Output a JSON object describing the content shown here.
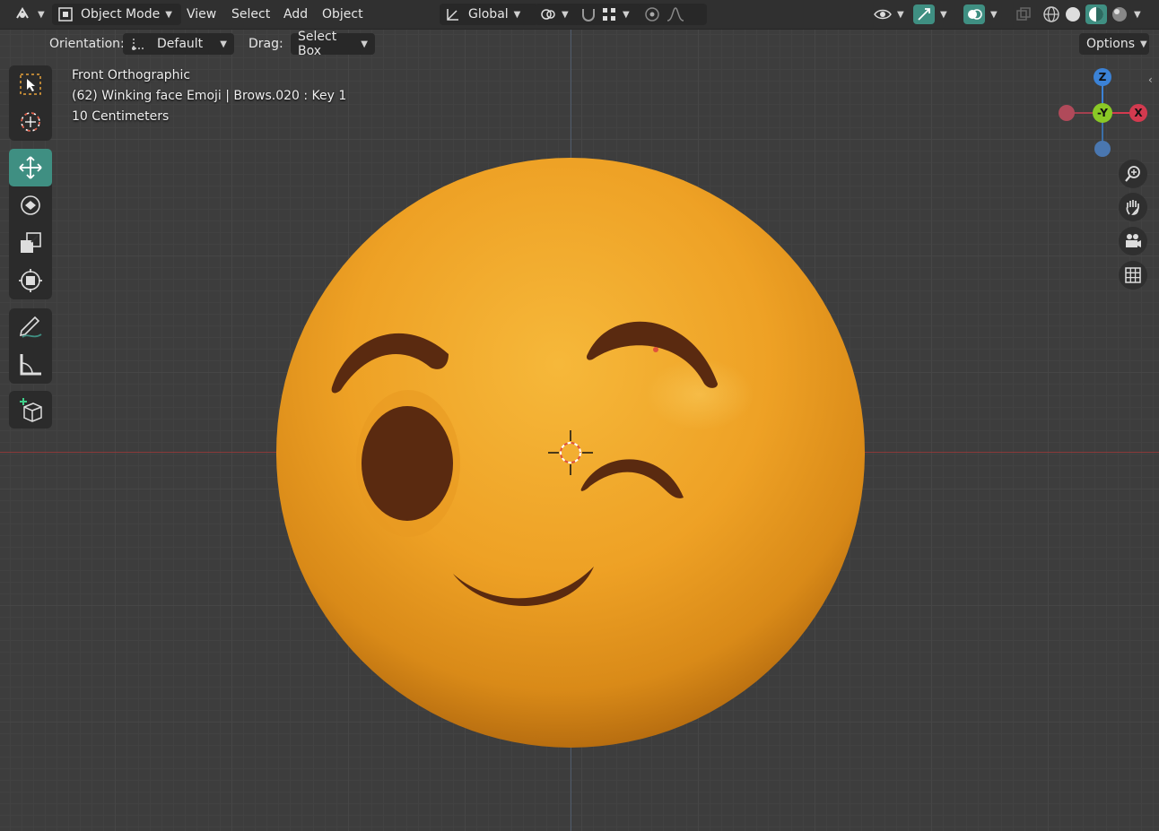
{
  "header": {
    "editor_type_icon": "editor-type-icon",
    "mode": "Object Mode",
    "menus": [
      "View",
      "Select",
      "Add",
      "Object"
    ],
    "transform_orientation": "Global",
    "options_label": "Options"
  },
  "tool_settings": {
    "orientation_label": "Orientation:",
    "orientation_value": "Default",
    "drag_label": "Drag:",
    "drag_value": "Select Box"
  },
  "overlay": {
    "view_name": "Front Orthographic",
    "object_info": "(62) Winking face Emoji | Brows.020 : Key 1",
    "scale": "10 Centimeters"
  },
  "gizmo": {
    "z_label": "Z",
    "y_label": "-Y",
    "x_label": "X"
  },
  "colors": {
    "accent_active_tool": "#3f8f82",
    "x_axis": "#d33a4f",
    "y_axis": "#8ac926",
    "z_axis": "#3b82d6",
    "emoji_face": "#f2a526",
    "emoji_features": "#5a2a10"
  },
  "left_tools": [
    "select-box-icon",
    "cursor-icon",
    "move-icon",
    "rotate-icon",
    "scale-icon",
    "transform-icon",
    "annotate-icon",
    "measure-icon",
    "add-cube-icon"
  ]
}
